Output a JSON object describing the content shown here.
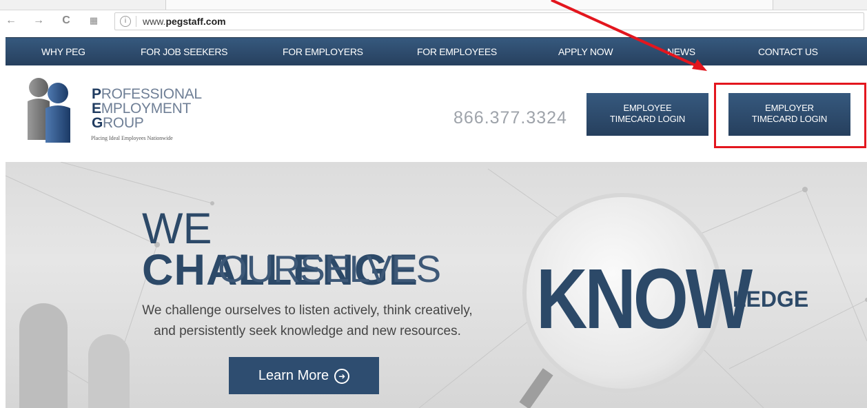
{
  "browser": {
    "back_icon": "back-arrow-icon",
    "forward_icon": "forward-arrow-icon",
    "reload_icon": "reload-icon",
    "apps_icon": "apps-grid-icon",
    "site_icon": "site-info-icon",
    "url_prefix": "www.",
    "url_domain": "pegstaff.com"
  },
  "nav": {
    "items": [
      "WHY PEG",
      "FOR JOB SEEKERS",
      "FOR EMPLOYERS",
      "FOR EMPLOYEES",
      "APPLY NOW",
      "NEWS",
      "CONTACT US"
    ]
  },
  "header": {
    "logo": {
      "line1_cap": "P",
      "line1_rest": "ROFESSIONAL",
      "line2_cap": "E",
      "line2_rest": "MPLOYMENT",
      "line3_cap": "G",
      "line3_rest": "ROUP",
      "tagline": "Placing Ideal Employees Nationwide"
    },
    "phone": "866.377.3324",
    "employee_login_line1": "EMPLOYEE",
    "employee_login_line2": "TIMECARD LOGIN",
    "employer_login_line1": "EMPLOYER",
    "employer_login_line2": "TIMECARD LOGIN"
  },
  "hero": {
    "title_thin": "WE ",
    "title_bold": "CHALLENGE",
    "subtitle": "OURSELVES",
    "body_line1": "We challenge ourselves to listen actively, think creatively,",
    "body_line2": "and persistently seek knowledge and new resources.",
    "button_label": "Learn More",
    "button_icon": "arrow-circle-right-icon",
    "graphic_big": "KNOW",
    "graphic_small": "LEDGE"
  },
  "annotation": {
    "color": "#e3161e"
  },
  "colors": {
    "brand_navy": "#2c4968",
    "nav_bar": "#2e4d70",
    "annotation_red": "#e3161e"
  }
}
